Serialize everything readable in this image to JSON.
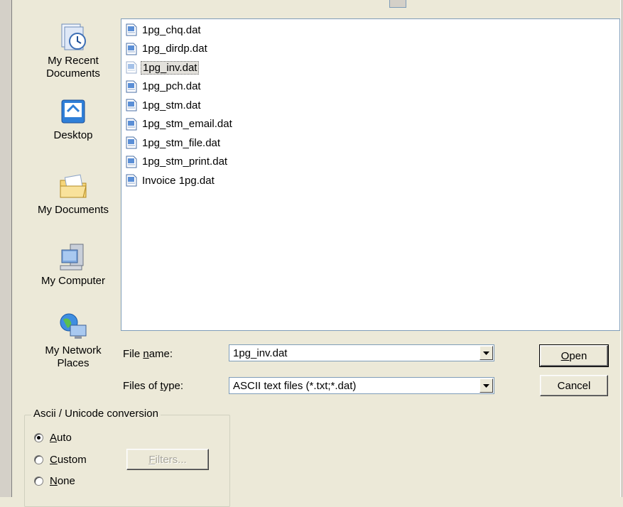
{
  "places": [
    {
      "label_line1": "My Recent",
      "label_line2": "Documents",
      "icon": "recent-documents-icon"
    },
    {
      "label_line1": "Desktop",
      "label_line2": "",
      "icon": "desktop-icon"
    },
    {
      "label_line1": "My Documents",
      "label_line2": "",
      "icon": "my-documents-icon"
    },
    {
      "label_line1": "My Computer",
      "label_line2": "",
      "icon": "my-computer-icon"
    },
    {
      "label_line1": "My Network",
      "label_line2": "Places",
      "icon": "network-places-icon"
    }
  ],
  "files": [
    {
      "name": "1pg_chq.dat",
      "selected": false
    },
    {
      "name": "1pg_dirdp.dat",
      "selected": false
    },
    {
      "name": "1pg_inv.dat",
      "selected": true
    },
    {
      "name": "1pg_pch.dat",
      "selected": false
    },
    {
      "name": "1pg_stm.dat",
      "selected": false
    },
    {
      "name": "1pg_stm_email.dat",
      "selected": false
    },
    {
      "name": "1pg_stm_file.dat",
      "selected": false
    },
    {
      "name": "1pg_stm_print.dat",
      "selected": false
    },
    {
      "name": "Invoice 1pg.dat",
      "selected": false
    }
  ],
  "file_name": {
    "label_pre": "File ",
    "label_accel": "n",
    "label_post": "ame:",
    "value": "1pg_inv.dat"
  },
  "file_type": {
    "label_pre": "Files of ",
    "label_accel": "t",
    "label_post": "ype:",
    "value": "ASCII text files (*.txt;*.dat)"
  },
  "buttons": {
    "open_accel": "O",
    "open_rest": "pen",
    "cancel": "Cancel",
    "filters_accel": "F",
    "filters_rest": "ilters..."
  },
  "conversion": {
    "title": "Ascii / Unicode conversion",
    "options": [
      {
        "accel": "A",
        "rest": "uto",
        "checked": true
      },
      {
        "accel": "C",
        "rest": "ustom",
        "checked": false
      },
      {
        "accel": "N",
        "rest": "one",
        "checked": false
      }
    ]
  }
}
